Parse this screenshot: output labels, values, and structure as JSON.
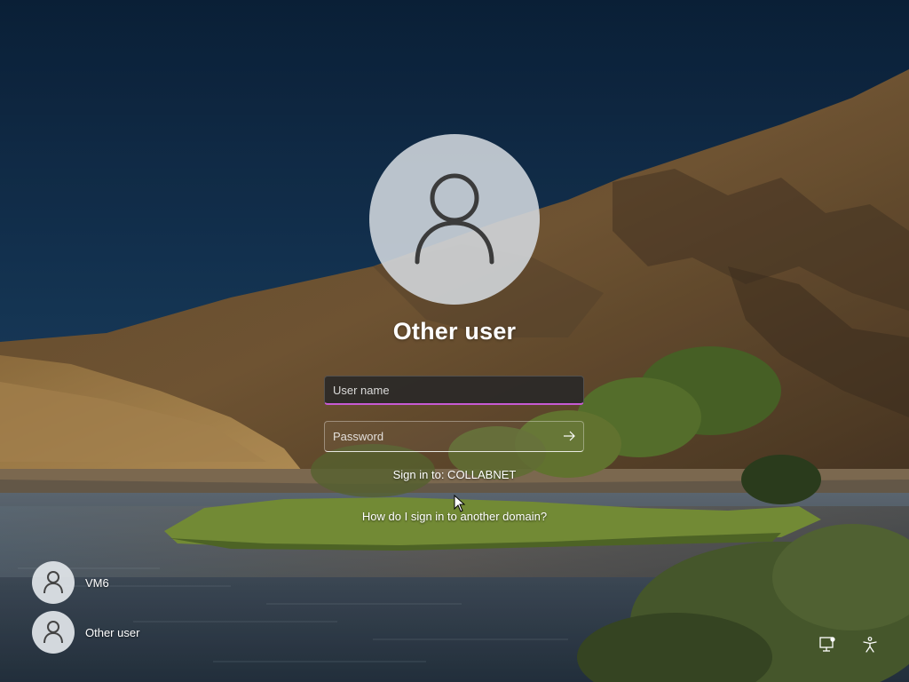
{
  "login": {
    "title": "Other user",
    "username_placeholder": "User name",
    "password_placeholder": "Password",
    "sign_in_to": "Sign in to: COLLABNET",
    "domain_link": "How do I sign in to another domain?"
  },
  "users": [
    {
      "label": "VM6",
      "icon": "person-icon"
    },
    {
      "label": "Other user",
      "icon": "person-icon"
    }
  ],
  "corner_icons": [
    {
      "name": "network-icon"
    },
    {
      "name": "accessibility-icon"
    }
  ],
  "colors": {
    "focus_accent": "#c75ad3",
    "sky": "#0f2742",
    "hill": "#8a6a3f",
    "water": "#4a5a6a"
  }
}
